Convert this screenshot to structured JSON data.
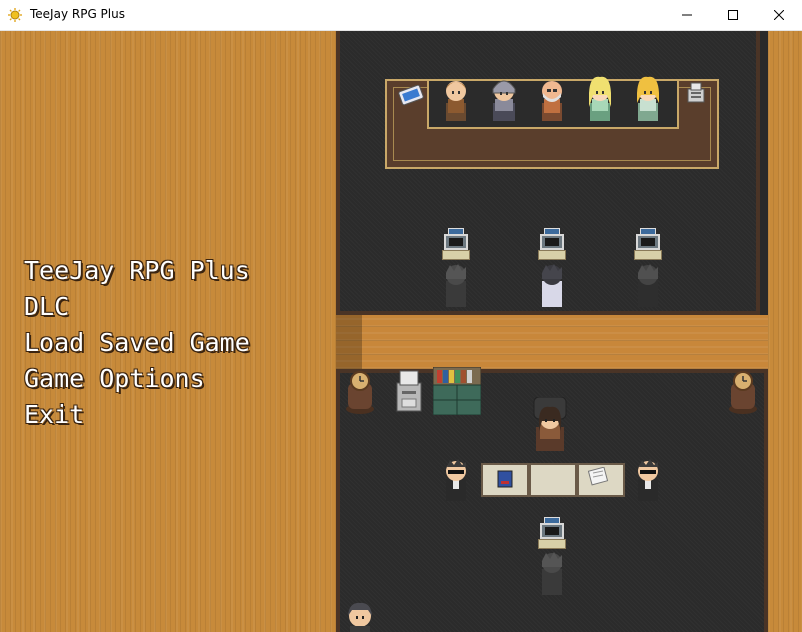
{
  "window": {
    "title": "TeeJay RPG Plus",
    "controls": {
      "minimize_icon": "minimize-icon",
      "maximize_icon": "maximize-icon",
      "close_icon": "close-icon"
    }
  },
  "menu": {
    "items": [
      {
        "label": "TeeJay RPG Plus"
      },
      {
        "label": "DLC"
      },
      {
        "label": "Load Saved Game"
      },
      {
        "label": "Game Options"
      },
      {
        "label": "Exit"
      }
    ]
  },
  "colors": {
    "wood": "#c78a3a",
    "floor_dark": "#2b2b2b",
    "trim": "#c9a868",
    "menu_text": "#ffffff"
  }
}
